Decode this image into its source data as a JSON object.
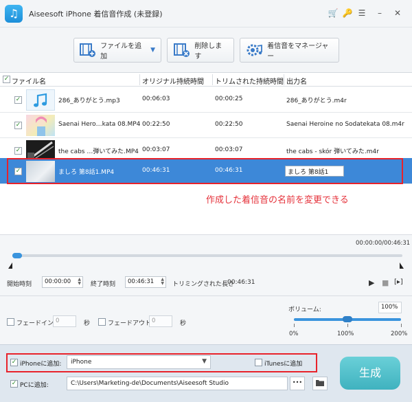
{
  "app": {
    "title": "Aiseesoft iPhone 着信音作成 (未登録)"
  },
  "titlebar_icons": [
    "cart-icon",
    "key-icon",
    "menu-icon",
    "minimize-icon",
    "close-icon"
  ],
  "toolbar": {
    "add_file": "ファイルを追加",
    "delete": "削除します",
    "manage": "着信音をマネージャー"
  },
  "table": {
    "headers": [
      "ファイル名",
      "オリジナル持続時間",
      "トリムされた持続時間",
      "出力名"
    ],
    "rows": [
      {
        "name": "286_ありがとう.mp3",
        "original": "00:06:03",
        "trimmed": "00:00:25",
        "output": "286_ありがとう.m4r",
        "checked": true,
        "selected": false,
        "thumb": "music-note"
      },
      {
        "name": "Saenai Hero…kata 08.MP4",
        "original": "00:22:50",
        "trimmed": "00:22:50",
        "output": "Saenai Heroine no Sodatekata 08.m4r",
        "checked": true,
        "selected": false,
        "thumb": "anime"
      },
      {
        "name": "the cabs …弾いてみた.MP4",
        "original": "00:03:07",
        "trimmed": "00:03:07",
        "output": "the cabs - skór 弾いてみた.m4r",
        "checked": true,
        "selected": false,
        "thumb": "guitar"
      },
      {
        "name": "ましろ 第8話1.MP4",
        "original": "00:46:31",
        "trimmed": "00:46:31",
        "output": "ましろ 第8話1",
        "checked": true,
        "selected": true,
        "thumb": "video"
      }
    ]
  },
  "annotation": {
    "text": "作成した着信音の名前を変更できる",
    "color": "#e5313a"
  },
  "player": {
    "time_readout": "00:00:00/00:46:31",
    "progress_fraction": 0.0,
    "start_label": "開始時刻",
    "start_value": "00:00:00",
    "end_label": "終了時刻",
    "end_value": "00:46:31",
    "trim_label": "トリミングされた長さ",
    "trim_value": "00:46:31"
  },
  "audio": {
    "fade_in_label": "フェードイン",
    "fade_in_value": "0",
    "fade_out_label": "フェードアウト",
    "fade_out_value": "0",
    "seconds_unit": "秒",
    "volume_label": "ボリューム:",
    "volume_value": "100%",
    "volume_fraction": 0.5,
    "volume_ticks": [
      "0%",
      "100%",
      "200%"
    ]
  },
  "footer": {
    "iphone_label": "iPhoneに追加:",
    "iphone_value": "iPhone",
    "itunes_label": "iTunesに追加",
    "pc_label": "PCに追加:",
    "pc_path": "C:\\Users\\Marketing-de\\Documents\\Aiseesoft Studio",
    "browse_label": "•••",
    "generate_label": "生成"
  },
  "colors": {
    "accent": "#3d88d8",
    "highlight": "#e8222a",
    "generate": "#4bbcc7"
  }
}
